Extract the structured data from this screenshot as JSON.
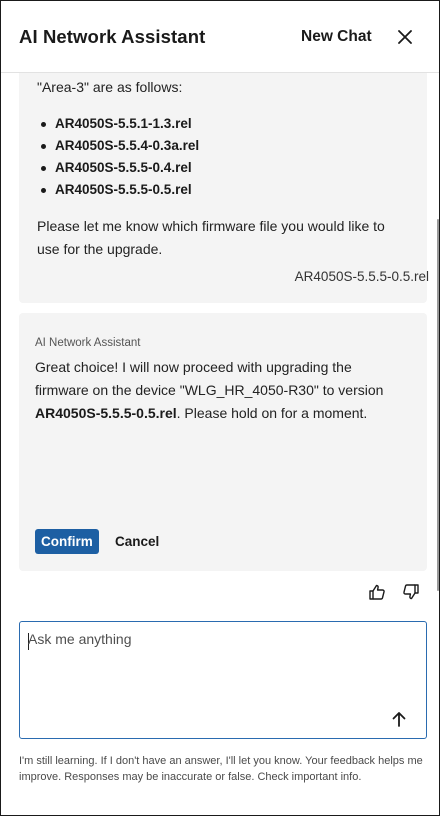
{
  "header": {
    "title": "AI Network Assistant",
    "new_chat_label": "New Chat",
    "close_icon": "close-icon"
  },
  "conversation": {
    "assistant_message_1": {
      "intro": "\"Area-3\" are as follows:",
      "firmware_options": [
        "AR4050S-5.5.1-1.3.rel",
        "AR4050S-5.5.4-0.3a.rel",
        "AR4050S-5.5.5-0.4.rel",
        "AR4050S-5.5.5-0.5.rel"
      ],
      "prompt": "Please let me know which firmware file you would like to use for the upgrade."
    },
    "user_message": "AR4050S-5.5.5-0.5.rel",
    "assistant_message_2": {
      "sender": "AI Network Assistant",
      "text_before": "Great choice! I will now proceed with upgrading the firmware on the device \"WLG_HR_4050-R30\" to version ",
      "text_bold": "AR4050S-5.5.5-0.5.rel",
      "text_after": ". Please hold on for a moment.",
      "confirm_label": "Confirm",
      "cancel_label": "Cancel"
    },
    "feedback_icons": [
      "thumbs-up-icon",
      "thumbs-down-icon"
    ]
  },
  "input": {
    "placeholder": "Ask me anything",
    "value": "",
    "send_icon": "arrow-up-icon"
  },
  "disclaimer": "I'm still learning. If I don't have an answer, I'll let you know. Your feedback helps me improve. Responses may be inaccurate or false. Check important info.",
  "colors": {
    "accent": "#1d5fa3",
    "input_border": "#2a6bb0",
    "bubble_bg": "#f4f4f4"
  }
}
